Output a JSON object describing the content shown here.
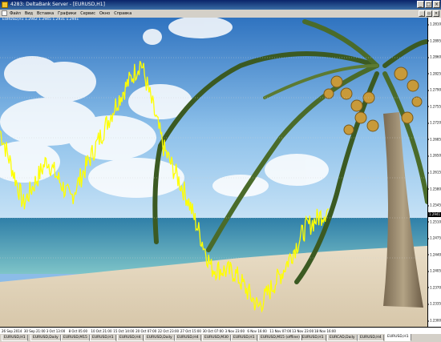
{
  "window": {
    "title": "4283: DeltaBank Server - [EURUSD,H1]",
    "minimize_label": "_",
    "maximize_label": "□",
    "close_label": "×"
  },
  "menu": {
    "items": [
      "Файл",
      "Вид",
      "Вставка",
      "Графики",
      "Сервис",
      "Окно",
      "Справка"
    ],
    "child_minimize": "_",
    "child_restore": "▫",
    "child_close": "×"
  },
  "chart": {
    "header": "EURUSD,H1 1.2942 1.2945 1.2931 1.2941",
    "current_price": "1.2941",
    "line_color": "#ffff00"
  },
  "price_axis": [
    "1.2810",
    "1.2895",
    "1.2860",
    "1.2825",
    "1.2790",
    "1.2755",
    "1.2720",
    "1.2685",
    "1.2650",
    "1.2615",
    "1.2580",
    "1.2545",
    "1.2510",
    "1.2475",
    "1.2440",
    "1.2405",
    "1.2370",
    "1.2335",
    "1.2300"
  ],
  "time_axis": [
    "26 Sep 2014",
    "30 Sep 21:00",
    "3 Oct 13:00",
    "8 Oct 05:00",
    "10 Oct 21:00",
    "15 Oct 14:00",
    "20 Oct 07:00",
    "22 Oct 23:00",
    "27 Oct 15:00",
    "30 Oct 07:00",
    "3 Nov 23:00",
    "6 Nov 16:00",
    "11 Nov 07:00",
    "13 Nov 23:00",
    "18 Nov 16:00"
  ],
  "tabs": [
    {
      "label": "EURUSD,H1",
      "active": false
    },
    {
      "label": "EURUSD,Daily",
      "active": false
    },
    {
      "label": "EURUSD,M15",
      "active": false
    },
    {
      "label": "EURUSD,H1",
      "active": false
    },
    {
      "label": "EURUSD,H4",
      "active": false
    },
    {
      "label": "EURUSD,Daily",
      "active": false
    },
    {
      "label": "EURUSD,H4",
      "active": false
    },
    {
      "label": "EURUSD,M30",
      "active": false
    },
    {
      "label": "EURUSD,H1",
      "active": false
    },
    {
      "label": "EURUSD,M15 (offline)",
      "active": false
    },
    {
      "label": "EURUSD,H1",
      "active": false
    },
    {
      "label": "EURCAD,Daily",
      "active": false
    },
    {
      "label": "EURUSD,H4",
      "active": false
    },
    {
      "label": "EURUSD,H1",
      "active": true
    }
  ],
  "chart_data": {
    "type": "line",
    "symbol": "EURUSD",
    "timeframe": "H1",
    "ylim": [
      1.23,
      1.293
    ],
    "x": [
      "26 Sep 2014",
      "30 Sep 21:00",
      "3 Oct 13:00",
      "8 Oct 05:00",
      "10 Oct 21:00",
      "15 Oct 14:00",
      "20 Oct 07:00",
      "22 Oct 23:00",
      "27 Oct 15:00",
      "30 Oct 07:00",
      "3 Nov 23:00",
      "6 Nov 16:00",
      "11 Nov 07:00",
      "13 Nov 23:00",
      "18 Nov 16:00"
    ],
    "series": [
      {
        "values": [
          1.27,
          1.255,
          1.264,
          1.256,
          1.266,
          1.276,
          1.284,
          1.266,
          1.256,
          1.242,
          1.241,
          1.234,
          1.241,
          1.25,
          1.254
        ]
      }
    ]
  }
}
